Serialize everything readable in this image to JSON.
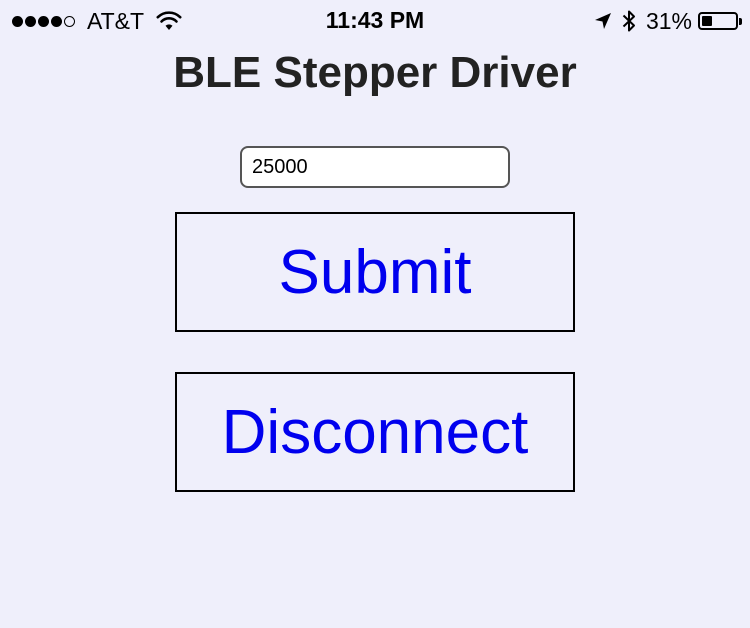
{
  "status_bar": {
    "signal_bars_filled": 4,
    "signal_bars_total": 5,
    "carrier": "AT&T",
    "time": "11:43 PM",
    "battery_percent": "31%",
    "battery_level": 0.31,
    "icons": [
      "wifi-icon",
      "location-arrow-icon",
      "bluetooth-icon",
      "battery-icon"
    ]
  },
  "page": {
    "title": "BLE Stepper Driver"
  },
  "form": {
    "input_value": "25000",
    "submit_label": "Submit",
    "disconnect_label": "Disconnect"
  },
  "colors": {
    "background": "#efeffb",
    "button_text": "#0000ee",
    "title_text": "#222222"
  }
}
